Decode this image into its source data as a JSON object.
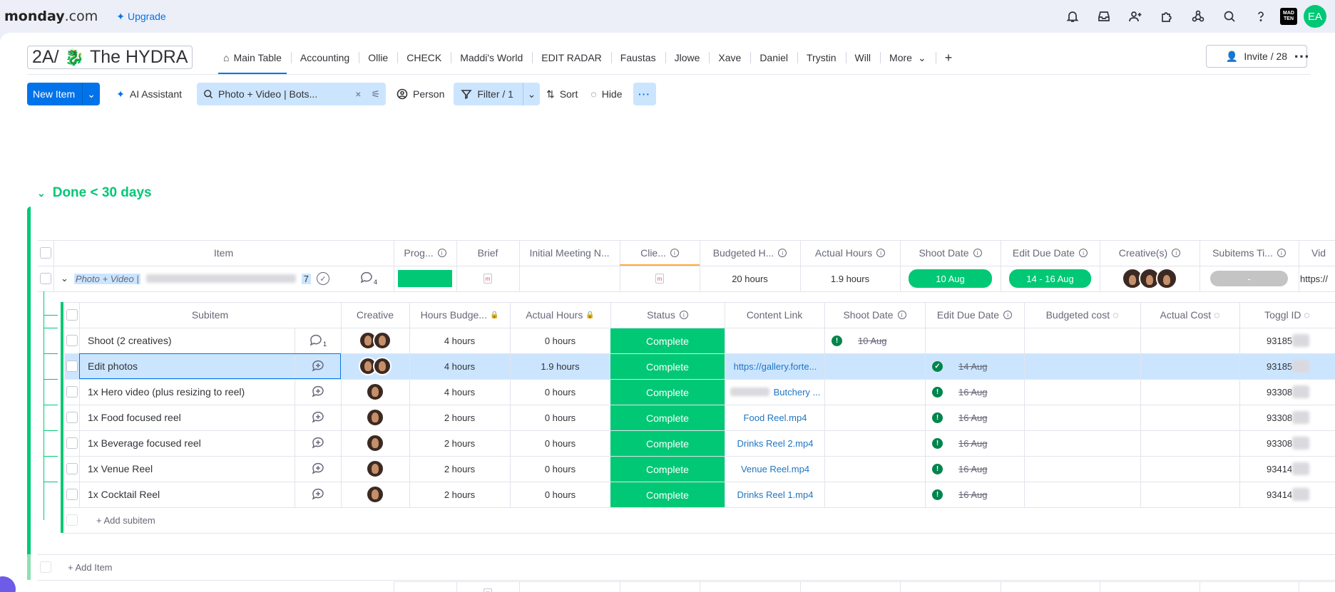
{
  "app": {
    "logo": "monday",
    "logo_suffix": ".com",
    "upgrade": "Upgrade",
    "user_initials": "EA",
    "app_badge": "MAD TEN"
  },
  "board": {
    "name": "2A/",
    "name_suffix": "The HYDRA",
    "tabs": [
      "Main Table",
      "Accounting",
      "Ollie",
      "CHECK",
      "Maddi's World",
      "EDIT RADAR",
      "Faustas",
      "Jlowe",
      "Xave",
      "Daniel",
      "Trystin",
      "Will",
      "More"
    ],
    "invite": "Invite / 28"
  },
  "toolbar": {
    "new_item": "New Item",
    "ai": "AI Assistant",
    "search_value": "Photo + Video | Bots...",
    "person": "Person",
    "filter": "Filter / 1",
    "sort": "Sort",
    "hide": "Hide"
  },
  "group": {
    "title": "Done < 30 days",
    "add_item": "+ Add Item"
  },
  "columns": [
    "Item",
    "Prog...",
    "Brief",
    "Initial Meeting N...",
    "Clie...",
    "Budgeted H...",
    "Actual Hours",
    "Shoot Date",
    "Edit Due Date",
    "Creative(s)",
    "Subitems Ti...",
    "Vid"
  ],
  "item": {
    "name": "Photo + Video |",
    "subitem_count": "7",
    "updates": "4",
    "budgeted": "20 hours",
    "actual": "1.9 hours",
    "shoot_date": "10 Aug",
    "edit_due": "14 - 16 Aug",
    "subitems_time": "-",
    "video": "https://"
  },
  "sub_columns": [
    "Subitem",
    "Creative",
    "Hours Budge...",
    "Actual Hours",
    "Status",
    "Content Link",
    "Shoot Date",
    "Edit Due Date",
    "Budgeted cost",
    "Actual Cost",
    "Toggl ID"
  ],
  "subitems": [
    {
      "name": "Shoot (2 creatives)",
      "updates": "1",
      "budget": "4 hours",
      "actual": "0 hours",
      "status": "Complete",
      "link": "",
      "shoot": "10 Aug",
      "due": "",
      "toggl": "93185",
      "creatives": 2
    },
    {
      "name": "Edit photos",
      "updates": "",
      "budget": "4 hours",
      "actual": "1.9 hours",
      "status": "Complete",
      "link": "https://gallery.forte...",
      "shoot": "",
      "due": "14 Aug",
      "toggl": "93185",
      "creatives": 2
    },
    {
      "name": "1x Hero video (plus resizing to reel)",
      "updates": "",
      "budget": "4 hours",
      "actual": "0 hours",
      "status": "Complete",
      "link": "Butchery ...",
      "shoot": "",
      "due": "16 Aug",
      "toggl": "93308",
      "creatives": 1
    },
    {
      "name": "1x Food focused reel",
      "updates": "",
      "budget": "2 hours",
      "actual": "0 hours",
      "status": "Complete",
      "link": "Food Reel.mp4",
      "shoot": "",
      "due": "16 Aug",
      "toggl": "93308",
      "creatives": 1
    },
    {
      "name": "1x Beverage focused reel",
      "updates": "",
      "budget": "2 hours",
      "actual": "0 hours",
      "status": "Complete",
      "link": "Drinks Reel 2.mp4",
      "shoot": "",
      "due": "16 Aug",
      "toggl": "93308",
      "creatives": 1
    },
    {
      "name": "1x Venue Reel",
      "updates": "",
      "budget": "2 hours",
      "actual": "0 hours",
      "status": "Complete",
      "link": "Venue Reel.mp4",
      "shoot": "",
      "due": "16 Aug",
      "toggl": "93414",
      "creatives": 1
    },
    {
      "name": "1x Cocktail Reel",
      "updates": "",
      "budget": "2 hours",
      "actual": "0 hours",
      "status": "Complete",
      "link": "Drinks Reel 1.mp4",
      "shoot": "",
      "due": "16 Aug",
      "toggl": "93414",
      "creatives": 1
    }
  ],
  "add_subitem": "+ Add subitem",
  "colors": {
    "accent": "#0073ea",
    "green": "#00c875",
    "selected": "#cce5ff",
    "orange": "#fdab3d"
  }
}
